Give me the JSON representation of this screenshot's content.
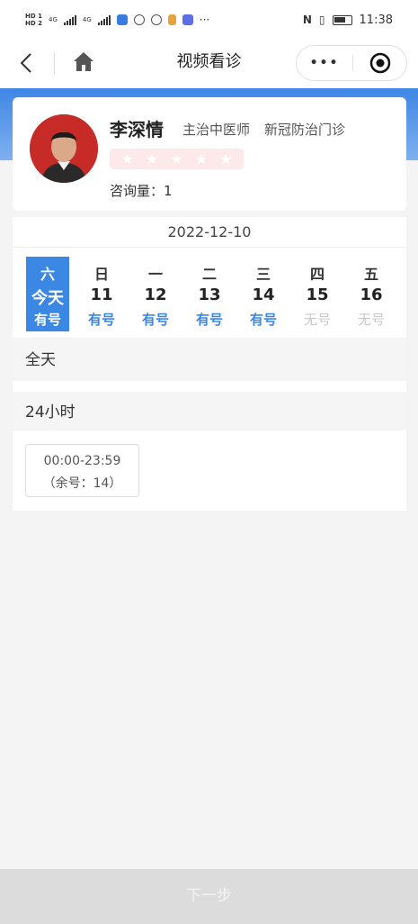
{
  "status_bar": {
    "hd1": "HD 1",
    "hd2": "HD 2",
    "net1": "4G",
    "net2": "4G",
    "more": "···",
    "time": "11:38"
  },
  "nav": {
    "title": "视频看诊",
    "more_glyph": "•••"
  },
  "doctor": {
    "name": "李深情",
    "title": "主治中医师",
    "department": "新冠防治门诊",
    "rating_stars": [
      "★",
      "★",
      "★",
      "★",
      "★"
    ],
    "consult_label": "咨询量：",
    "consult_count": "1"
  },
  "schedule": {
    "date": "2022-12-10",
    "days": [
      {
        "week": "六",
        "day": "今天",
        "status": "有号",
        "selected": true
      },
      {
        "week": "日",
        "day": "11",
        "status": "有号"
      },
      {
        "week": "一",
        "day": "12",
        "status": "有号"
      },
      {
        "week": "二",
        "day": "13",
        "status": "有号"
      },
      {
        "week": "三",
        "day": "14",
        "status": "有号"
      },
      {
        "week": "四",
        "day": "15",
        "status": "无号"
      },
      {
        "week": "五",
        "day": "16",
        "status": "无号"
      }
    ]
  },
  "sections": {
    "all_day": "全天",
    "hours24": "24小时"
  },
  "slots": [
    {
      "time": "00:00-23:59",
      "remaining": "（余号：14）"
    }
  ],
  "footer": {
    "next_label": "下一步"
  },
  "colors": {
    "accent": "#3b87e4",
    "unavailable": "#c8c8c8",
    "avatar_bg": "#c62b28"
  }
}
